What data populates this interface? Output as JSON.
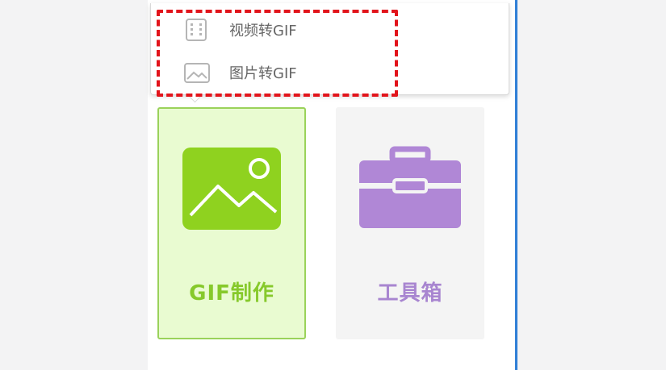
{
  "menu": {
    "items": [
      {
        "label": "视频转GIF",
        "icon": "video-file-icon"
      },
      {
        "label": "图片转GIF",
        "icon": "image-icon"
      }
    ]
  },
  "tiles": [
    {
      "label": "GIF制作",
      "icon": "gif-image-icon",
      "color": "#86c92b",
      "selected": true
    },
    {
      "label": "工具箱",
      "icon": "toolbox-icon",
      "color": "#a885d0",
      "selected": false
    }
  ],
  "colors": {
    "highlight": "#e2141b",
    "accent_green": "#86c92b",
    "accent_purple": "#a885d0",
    "window_edge": "#2f7fd6"
  }
}
